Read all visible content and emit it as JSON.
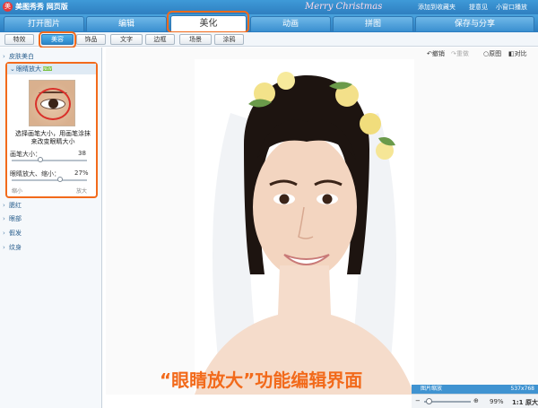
{
  "titlebar": {
    "title": "美图秀秀 网页版",
    "add_favorite": "添加到收藏夹",
    "help": "提意见",
    "mini_window": "小窗口播放"
  },
  "decoration": {
    "banner_text": "Merry Christmas"
  },
  "tabs": [
    {
      "label": "打开图片",
      "active": false
    },
    {
      "label": "编辑",
      "active": false
    },
    {
      "label": "美化",
      "active": true
    },
    {
      "label": "动画",
      "active": false
    },
    {
      "label": "拼图",
      "active": false
    },
    {
      "label": "保存与分享",
      "active": false
    }
  ],
  "subtoolbar": [
    {
      "label": "特效",
      "active": false
    },
    {
      "label": "美容",
      "active": true
    },
    {
      "label": "饰品",
      "active": false
    },
    {
      "label": "文字",
      "active": false
    },
    {
      "label": "边框",
      "active": false
    },
    {
      "label": "场景",
      "active": false
    },
    {
      "label": "涂鸦",
      "active": false
    }
  ],
  "sidebar": {
    "items": [
      {
        "label": "皮肤美白"
      },
      {
        "label": "眼睛放大"
      },
      {
        "label": "腮红"
      },
      {
        "label": "眼部"
      },
      {
        "label": "假发"
      },
      {
        "label": "纹身"
      }
    ],
    "panel": {
      "badge": "NEW",
      "description": "选择画笔大小，用画笔涂抹来改变眼睛大小",
      "brush_size_label": "画笔大小：",
      "brush_size_value": "38",
      "brush_size_level": 0.38,
      "eye_ratio_label": "眼睛放大、缩小：",
      "eye_ratio_value": "27%",
      "eye_ratio_level": 0.64,
      "shrink_hint": "缩小",
      "enlarge_hint": "放大"
    }
  },
  "editbar": {
    "undo": "撤销",
    "redo": "重做",
    "original": "原图",
    "compare": "对比"
  },
  "caption": "“眼睛放大”功能编辑界面",
  "status": {
    "zoom_title": "图片缩放",
    "image_size": "537x768",
    "zoom_value": "99%",
    "actual_size": "1:1 原大"
  },
  "colors": {
    "highlight": "#f26a1b",
    "accent_blue": "#2f7fc0"
  }
}
